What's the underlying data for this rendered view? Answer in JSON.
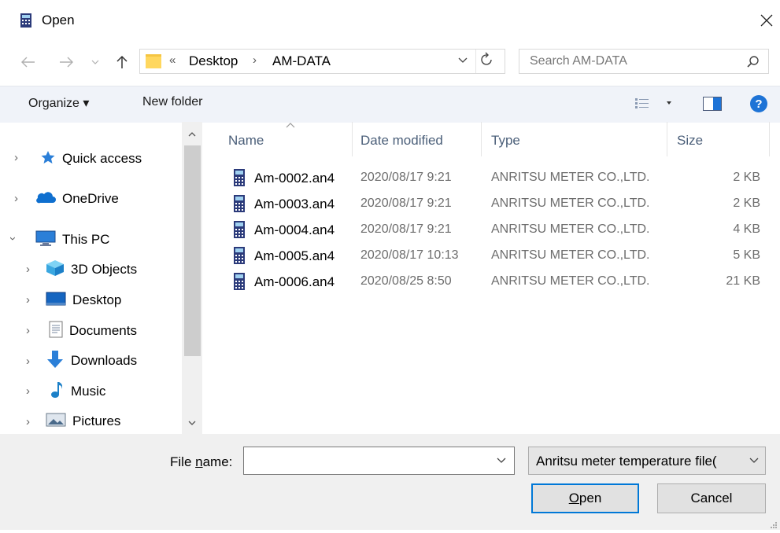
{
  "window": {
    "title": "Open",
    "close_icon": "close-icon"
  },
  "address": {
    "breadcrumb_overflow": "«",
    "crumbs": [
      "Desktop",
      "AM-DATA"
    ],
    "separator": "›"
  },
  "search": {
    "placeholder": "Search AM-DATA",
    "value": ""
  },
  "toolbar": {
    "organize_label": "Organize ▾",
    "new_folder_label": "New folder"
  },
  "nav_pane": {
    "items": [
      {
        "label": "Quick access",
        "icon": "star-icon"
      },
      {
        "label": "OneDrive",
        "icon": "cloud-icon"
      },
      {
        "label": "This PC",
        "icon": "computer-icon"
      },
      {
        "label": "3D Objects",
        "icon": "cube-icon"
      },
      {
        "label": "Desktop",
        "icon": "desktop-icon"
      },
      {
        "label": "Documents",
        "icon": "document-icon"
      },
      {
        "label": "Downloads",
        "icon": "download-arrow-icon"
      },
      {
        "label": "Music",
        "icon": "music-note-icon"
      },
      {
        "label": "Pictures",
        "icon": "picture-icon"
      }
    ]
  },
  "columns": {
    "name": "Name",
    "date": "Date modified",
    "type": "Type",
    "size": "Size"
  },
  "files": [
    {
      "name": "Am-0002.an4",
      "date": "2020/08/17 9:21",
      "type": "ANRITSU METER CO.,LTD.",
      "size": "2 KB"
    },
    {
      "name": "Am-0003.an4",
      "date": "2020/08/17 9:21",
      "type": "ANRITSU METER CO.,LTD.",
      "size": "2 KB"
    },
    {
      "name": "Am-0004.an4",
      "date": "2020/08/17 9:21",
      "type": "ANRITSU METER CO.,LTD.",
      "size": "4 KB"
    },
    {
      "name": "Am-0005.an4",
      "date": "2020/08/17 10:13",
      "type": "ANRITSU METER CO.,LTD.",
      "size": "5 KB"
    },
    {
      "name": "Am-0006.an4",
      "date": "2020/08/25 8:50",
      "type": "ANRITSU METER CO.,LTD.",
      "size": "21 KB"
    }
  ],
  "bottom": {
    "file_name_label_pre": "File ",
    "file_name_label_u": "n",
    "file_name_label_post": "ame:",
    "file_name_value": "",
    "filter_value": "Anritsu meter temperature file(",
    "open_label_u": "O",
    "open_label_rest": "pen",
    "cancel_label": "Cancel"
  },
  "colors": {
    "accent": "#0078d7",
    "toolbar_bg": "#f0f3f9",
    "panel_bg": "#f0f0f0",
    "header_text": "#4c607a",
    "help_blue": "#1e73d6"
  }
}
